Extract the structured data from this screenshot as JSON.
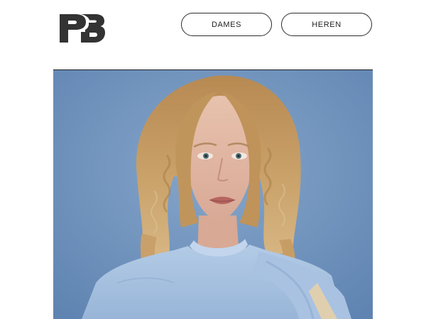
{
  "header": {
    "logo_text": "PB",
    "nav": [
      {
        "label": "DAMES"
      },
      {
        "label": "HEREN"
      }
    ]
  },
  "hero": {
    "image": "portrait-woman-curly-hair-blue-sweater",
    "colors": {
      "background": "#6f93bd",
      "hair": "#c2985f",
      "sweater": "#a6c0de"
    }
  }
}
